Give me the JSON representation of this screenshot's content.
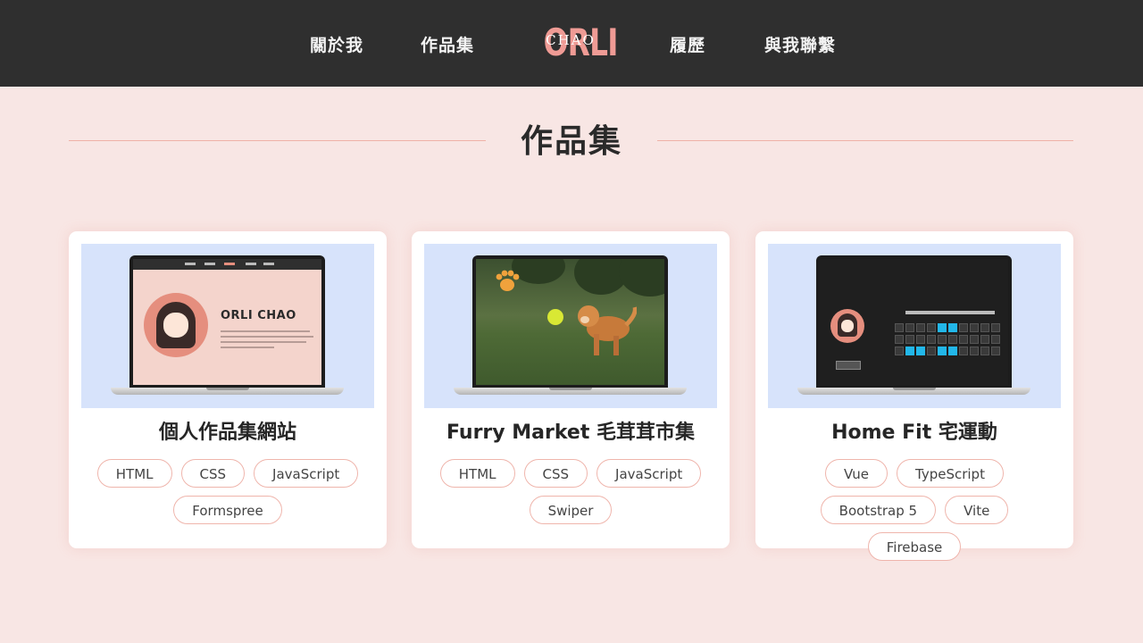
{
  "nav": {
    "links": [
      "關於我",
      "作品集",
      "履歷",
      "與我聯繫"
    ],
    "logo": {
      "main": "ORLI",
      "sub": "CHAO"
    }
  },
  "section": {
    "title": "作品集"
  },
  "projects": [
    {
      "title": "個人作品集網站",
      "tags": [
        "HTML",
        "CSS",
        "JavaScript",
        "Formspree"
      ],
      "preview_text": "ORLI CHAO"
    },
    {
      "title": "Furry Market 毛茸茸市集",
      "tags": [
        "HTML",
        "CSS",
        "JavaScript",
        "Swiper"
      ]
    },
    {
      "title": "Home Fit 宅運動",
      "tags": [
        "Vue",
        "TypeScript",
        "Bootstrap 5",
        "Vite",
        "Firebase"
      ]
    }
  ],
  "colors": {
    "nav_bg": "#2f2f2f",
    "page_bg": "#f8e6e4",
    "accent": "#ef9b95",
    "tag_border": "#efb5ac",
    "thumb_bg": "#d7e3fb"
  }
}
